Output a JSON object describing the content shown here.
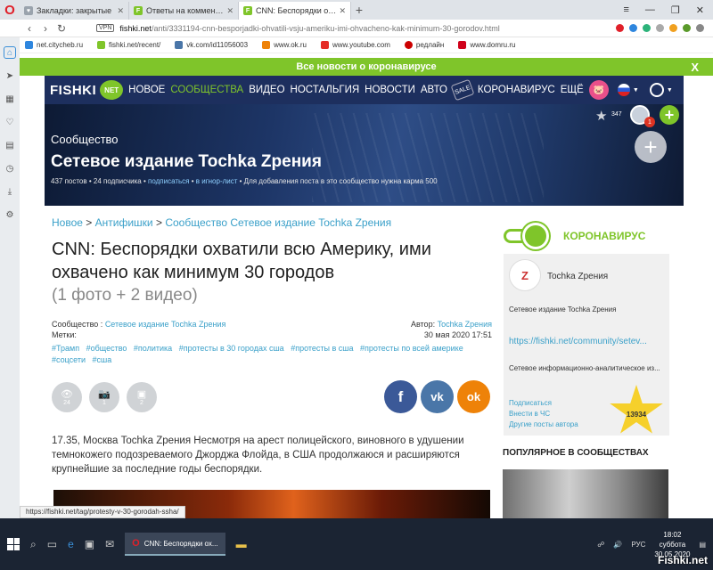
{
  "browser": {
    "tabs": [
      {
        "label": "Закладки: закрытые",
        "color": "#9aa3ad"
      },
      {
        "label": "Ответы на комментарии",
        "color": "#7fc52a"
      },
      {
        "label": "CNN: Беспорядки охвати",
        "color": "#7fc52a"
      }
    ],
    "new_tab": "+",
    "url_domain": "fishki.net",
    "url_path": "/anti/3331194-cnn-besporjadki-ohvatili-vsju-ameriku-imi-ohvacheno-kak-minimum-30-gorodov.html",
    "vpn": "VPN",
    "bookmarks": [
      {
        "label": "net.citycheb.ru",
        "color": "#2e86de"
      },
      {
        "label": "fishki.net/recent/",
        "color": "#7fc52a"
      },
      {
        "label": "vk.com/id11056003",
        "color": "#4a76a8"
      },
      {
        "label": "www.ok.ru",
        "color": "#ee8208"
      },
      {
        "label": "www.youtube.com",
        "color": "#e52d27"
      },
      {
        "label": "редлайн",
        "color": "#c00"
      },
      {
        "label": "www.domru.ru",
        "color": "#d0021b"
      }
    ],
    "status_url": "https://fishki.net/tag/protesty-v-30-gorodah-ssha/"
  },
  "covid_bar": {
    "label": "Все новости о коронавирусе",
    "close": "X"
  },
  "nav": {
    "logo": "FISHKI",
    "logo_badge": "NET",
    "items": [
      "НОВОЕ",
      "СООБЩЕСТВА",
      "ВИДЕО",
      "НОСТАЛЬГИЯ",
      "НОВОСТИ",
      "АВТО"
    ],
    "tag_label": "SALE",
    "covid": "КОРОНАВИРУС",
    "more": "ЕЩЁ"
  },
  "hero": {
    "subtitle": "Сообщество",
    "title": "Сетевое издание Tochka Zрения",
    "posts": "437 постов",
    "subscribers": "24 подписчика",
    "subscribe": "подписаться",
    "ignore": "в игнор-лист",
    "karma_note": "Для добавления поста в это сообщество нужна карма 500",
    "stars_count": "347",
    "notif_count": "1"
  },
  "breadcrumb": {
    "home": "Новое",
    "section": "Антифишки",
    "community": "Сообщество Сетевое издание Tochka Zрения"
  },
  "article": {
    "title": "CNN: Беспорядки охватили всю Америку, ими охвачено как минимум 30 городов",
    "subtitle": "(1 фото + 2 видео)",
    "community_label": "Сообщество :",
    "community_name": "Сетевое издание Tochka Zрения",
    "author_label": "Автор:",
    "author_name": "Tochka Zрения",
    "tags_label": "Метки:",
    "date": "30 мая 2020 17:51",
    "tags": [
      "#Трамп",
      "#общество",
      "#политика",
      "#протесты в 30 городах сша",
      "#протесты в сша",
      "#протесты по всей америке",
      "#соцсети",
      "#сша"
    ],
    "stats": {
      "views": "24",
      "photos": "1",
      "videos": "2"
    },
    "body": "17.35, Москва Tochka Zрения Несмотря на арест полицейского, виновного в удушении темнокожего подозреваемого Джорджа Флойда, в США продолжаюся и расширяются крупнейшие за последние годы беспорядки."
  },
  "share": {
    "fb": "f",
    "vk": "vk",
    "ok": "ok"
  },
  "sidebar": {
    "covid_logo": "КОРОНАВИРУС",
    "card": {
      "avatar": "Z",
      "name": "Tochka Zрения",
      "desc": "Сетевое издание Tochka Zрения",
      "link": "https://fishki.net/community/setev...",
      "line": "Сетевое информационно-аналитическое из...",
      "subscribe": "Подписаться",
      "chat": "Внести в ЧС",
      "other": "Другие посты автора",
      "karma": "13934"
    },
    "popular": "ПОПУЛЯРНОЕ В СООБЩЕСТВАХ"
  },
  "taskbar": {
    "task_label": "CNN: Беспорядки ох...",
    "lang": "РУС",
    "time": "18:02",
    "day": "суббота",
    "date": "30.05.2020",
    "watermark": "Fishki.net"
  }
}
